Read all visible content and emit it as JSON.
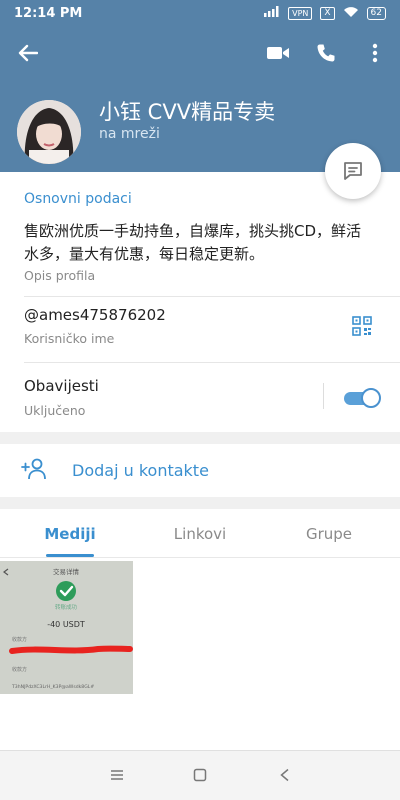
{
  "status_bar": {
    "time": "12:14 PM",
    "vpn": "VPN",
    "x_badge": "X",
    "battery": "62"
  },
  "profile": {
    "name": "小钰 CVV精品专卖",
    "status": "na mreži"
  },
  "info": {
    "section_title": "Osnovni podaci",
    "bio": "售欧洲优质一手劫持鱼，自爆库，挑头挑CD，鲜活水多，量大有优惠，每日稳定更新。",
    "bio_label": "Opis profila",
    "username": "@ames475876202",
    "username_label": "Korisničko ime",
    "notifications": "Obavijesti",
    "notifications_state": "Uključeno",
    "notifications_on": true
  },
  "add_contact": {
    "label": "Dodaj u kontakte"
  },
  "tabs": [
    {
      "label": "Mediji"
    },
    {
      "label": "Linkovi"
    },
    {
      "label": "Grupe"
    }
  ],
  "media": {
    "thumb_title": "交易详情",
    "thumb_sub": "转账成功",
    "thumb_amount": "-40 USDT",
    "thumb_row1": "收款方",
    "thumb_row2": "收款方",
    "thumb_addr": "T3hNJPdzXC3LrH_K3P@aWsdk8GL#"
  },
  "colors": {
    "header": "#5682a8",
    "accent": "#3a8fcf",
    "toggle": "#5aa0d8"
  }
}
